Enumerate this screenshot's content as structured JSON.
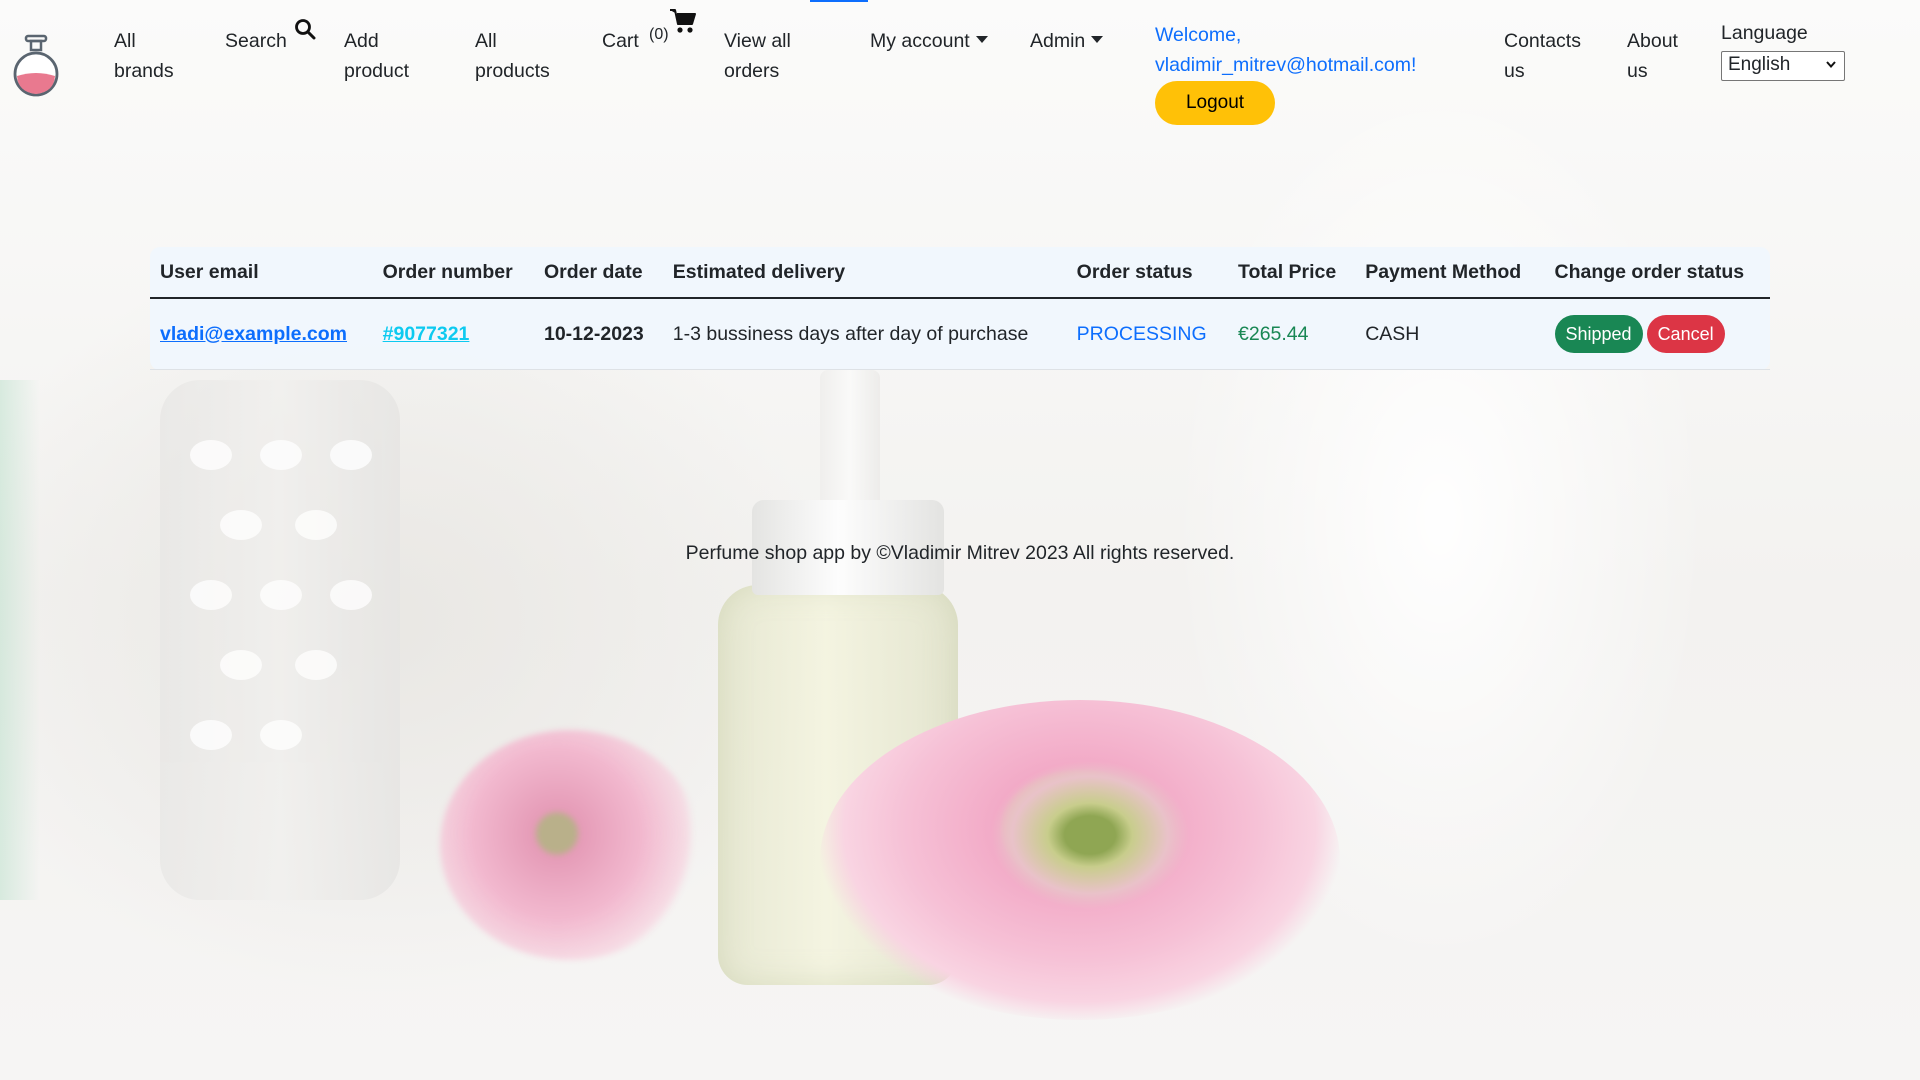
{
  "nav": {
    "all_brands": [
      "All",
      "brands"
    ],
    "search": "Search",
    "add_product": [
      "Add",
      "product"
    ],
    "all_products": [
      "All",
      "products"
    ],
    "cart": "Cart",
    "cart_count": "(0)",
    "view_all_orders": [
      "View all",
      "orders"
    ],
    "my_account": "My account",
    "admin": "Admin",
    "welcome_line1": "Welcome,",
    "welcome_line2": "vladimir_mitrev@hotmail.com!",
    "logout": "Logout",
    "contacts_us": [
      "Contacts",
      "us"
    ],
    "about_us": [
      "About",
      "us"
    ],
    "language_label": "Language",
    "language_selected": "English"
  },
  "orders_table": {
    "headers": [
      "User email",
      "Order number",
      "Order date",
      "Estimated delivery",
      "Order status",
      "Total Price",
      "Payment Method",
      "Change order status"
    ],
    "rows": [
      {
        "email": "vladi@example.com",
        "order_number": "#9077321",
        "order_date": "10-12-2023",
        "estimated_delivery": "1-3 bussiness days after day of purchase",
        "status": "PROCESSING",
        "total_price": "€265.44",
        "payment_method": "CASH",
        "actions": [
          "Shipped",
          "Cancel"
        ]
      }
    ]
  },
  "footer": "Perfume shop app by ©Vladimir Mitrev 2023 All rights reserved.",
  "colors": {
    "primary": "#0d6efd",
    "info": "#0dcaf0",
    "success": "#198754",
    "danger": "#dc3545",
    "warning": "#ffc107"
  },
  "icons": [
    "perfume-logo-icon",
    "search-icon",
    "cart-icon",
    "caret-down-icon",
    "chevron-down-icon"
  ]
}
